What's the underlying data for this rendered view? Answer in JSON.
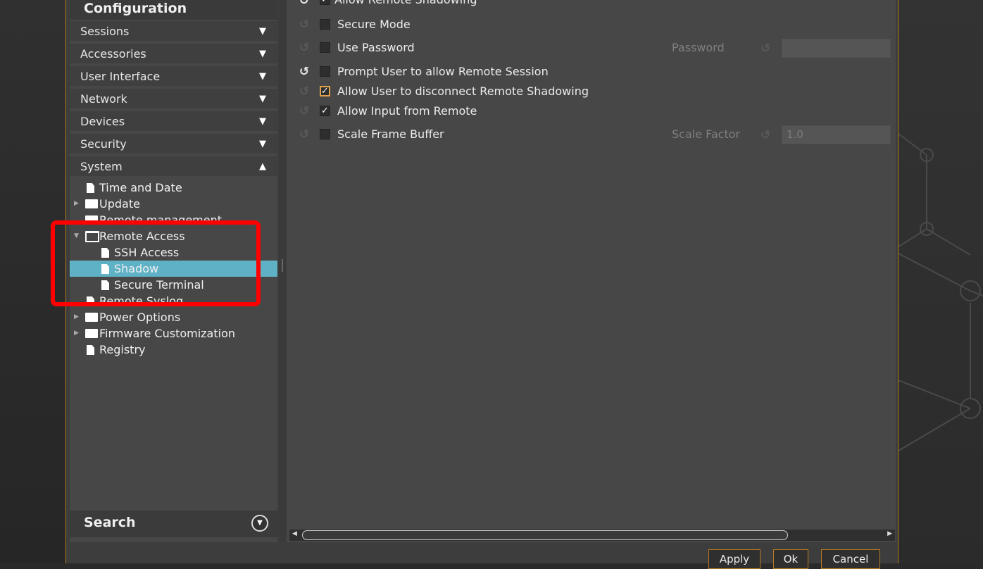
{
  "sidebar": {
    "title": "Configuration",
    "categories": [
      {
        "label": "Sessions",
        "arrow": "▼"
      },
      {
        "label": "Accessories",
        "arrow": "▼"
      },
      {
        "label": "User Interface",
        "arrow": "▼"
      },
      {
        "label": "Network",
        "arrow": "▼"
      },
      {
        "label": "Devices",
        "arrow": "▼"
      },
      {
        "label": "Security",
        "arrow": "▼"
      },
      {
        "label": "System",
        "arrow": "▲"
      }
    ],
    "tree": [
      {
        "label": "Time and Date"
      },
      {
        "label": "Update"
      },
      {
        "label": "Remote management"
      },
      {
        "label": "Remote Access"
      },
      {
        "label": "SSH Access"
      },
      {
        "label": "Shadow"
      },
      {
        "label": "Secure Terminal"
      },
      {
        "label": "Remote Syslog"
      },
      {
        "label": "Power Options"
      },
      {
        "label": "Firmware Customization"
      },
      {
        "label": "Registry"
      }
    ],
    "search_label": "Search",
    "search_btn": "▼"
  },
  "settings": {
    "top_partial": "Allow Remote Shadowing",
    "rows": [
      {
        "label": "Secure Mode",
        "checked": ""
      },
      {
        "label": "Use Password",
        "checked": ""
      },
      {
        "label": "Prompt User to allow Remote Session",
        "checked": ""
      },
      {
        "label": "Allow User to disconnect Remote Shadowing",
        "checked": "✓"
      },
      {
        "label": "Allow Input from Remote",
        "checked": "✓"
      },
      {
        "label": "Scale Frame Buffer",
        "checked": ""
      }
    ],
    "password_label": "Password",
    "password_value": "",
    "scale_label": "Scale Factor",
    "scale_value": "1.0"
  },
  "reset_icon": "↺",
  "footer": {
    "apply": "Apply",
    "ok": "Ok",
    "cancel": "Cancel"
  }
}
